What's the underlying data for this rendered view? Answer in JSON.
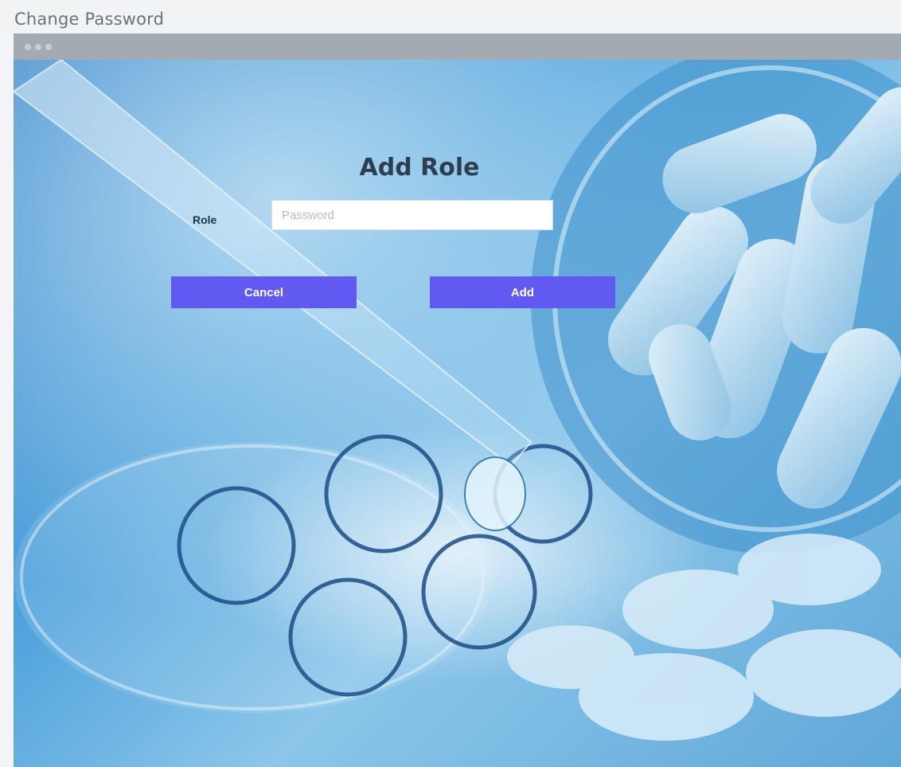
{
  "header": {
    "title": "Change Password"
  },
  "form": {
    "title": "Add Role",
    "role_label": "Role",
    "role_input": {
      "value": "",
      "placeholder": "Password"
    },
    "cancel_label": "Cancel",
    "add_label": "Add"
  },
  "colors": {
    "button": "#6159f2",
    "title": "#2c3e50",
    "window_bar": "#a2aab2"
  }
}
